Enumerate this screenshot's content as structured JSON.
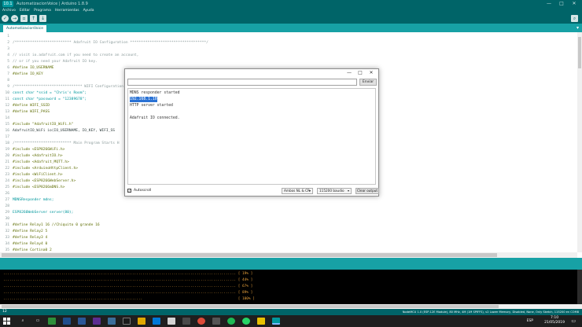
{
  "window": {
    "title": "AutomatizacionVoice | Arduino 1.8.9",
    "logo_text": "10.1",
    "minimize": "—",
    "maximize": "□",
    "close": "✕"
  },
  "menu": [
    "Archivo",
    "Editar",
    "Programa",
    "Herramientas",
    "Ayuda"
  ],
  "toolbar": {
    "verify_icon": "check-icon",
    "upload_icon": "arrow-right-icon",
    "new_icon": "new-file-icon",
    "open_icon": "arrow-up-icon",
    "save_icon": "arrow-down-icon",
    "serial_icon": "magnifier-icon",
    "verify_glyph": "✓",
    "upload_glyph": "→",
    "new_glyph": "▫",
    "open_glyph": "↑",
    "save_glyph": "↓",
    "serial_glyph": "⌕"
  },
  "tabs": {
    "active": "AutomatizacionVoice",
    "menu_glyph": "▾"
  },
  "code_lines": [
    {
      "n": "1",
      "text": "",
      "kind": "plain"
    },
    {
      "n": "2",
      "text": "/************************** Adafruit IO Configuration ***********************************/",
      "kind": "comment"
    },
    {
      "n": "3",
      "text": "",
      "kind": "plain"
    },
    {
      "n": "4",
      "text": "// visit io.adafruit.com if you need to create an account,",
      "kind": "comment"
    },
    {
      "n": "5",
      "text": "// or if you need your Adafruit IO key.",
      "kind": "comment"
    },
    {
      "n": "6",
      "text": "#define IO_USERNAME",
      "kind": "directive"
    },
    {
      "n": "7",
      "text": "#define IO_KEY",
      "kind": "directive"
    },
    {
      "n": "8",
      "text": "",
      "kind": "plain"
    },
    {
      "n": "9",
      "text": "/******************************* WIFI Configuration",
      "kind": "comment"
    },
    {
      "n": "10",
      "text": "const char *ssid = \"Chris's Room\";",
      "kind": "type"
    },
    {
      "n": "11",
      "text": "const char *password = \"12389678\";",
      "kind": "type"
    },
    {
      "n": "12",
      "text": "#define WIFI_SSID",
      "kind": "directive"
    },
    {
      "n": "13",
      "text": "#define WIFI_PASS",
      "kind": "directive"
    },
    {
      "n": "14",
      "text": "",
      "kind": "plain"
    },
    {
      "n": "15",
      "text": "#include \"AdafruitIO_WiFi.h\"",
      "kind": "directive"
    },
    {
      "n": "16",
      "text": "AdafruitIO_WiFi io(IO_USERNAME, IO_KEY, WIFI_SS",
      "kind": "plain"
    },
    {
      "n": "17",
      "text": "",
      "kind": "plain"
    },
    {
      "n": "18",
      "text": "/************************** Main Program Starts H",
      "kind": "comment"
    },
    {
      "n": "19",
      "text": "#include <ESP8266WiFi.h>",
      "kind": "directive"
    },
    {
      "n": "20",
      "text": "#include <AdafruitIO.h>",
      "kind": "directive"
    },
    {
      "n": "21",
      "text": "#include <Adafruit_MQTT.h>",
      "kind": "directive"
    },
    {
      "n": "22",
      "text": "#include <ArduinoHttpClient.h>",
      "kind": "directive"
    },
    {
      "n": "23",
      "text": "#include <WiFiClient.h>",
      "kind": "directive"
    },
    {
      "n": "24",
      "text": "#include <ESP8266WebServer.h>",
      "kind": "directive"
    },
    {
      "n": "25",
      "text": "#include <ESP8266mDNS.h>",
      "kind": "directive"
    },
    {
      "n": "26",
      "text": "",
      "kind": "plain"
    },
    {
      "n": "27",
      "text": "MDNSResponder mdns;",
      "kind": "type"
    },
    {
      "n": "28",
      "text": "",
      "kind": "plain"
    },
    {
      "n": "29",
      "text": "ESP8266WebServer server(80);",
      "kind": "type"
    },
    {
      "n": "30",
      "text": "",
      "kind": "plain"
    },
    {
      "n": "31",
      "text": "#define Relay1 16 //Chiquito 0 grande 16",
      "kind": "directive"
    },
    {
      "n": "32",
      "text": "#define Relay2 5",
      "kind": "directive"
    },
    {
      "n": "33",
      "text": "#define Relay3 4",
      "kind": "directive"
    },
    {
      "n": "34",
      "text": "#define Relay4 0",
      "kind": "directive"
    },
    {
      "n": "35",
      "text": "#define Cortina0 2",
      "kind": "directive"
    },
    {
      "n": "36",
      "text": "#define CortinaC 12",
      "kind": "directive"
    }
  ],
  "serial_monitor": {
    "minimize": "—",
    "maximize": "□",
    "close": "✕",
    "input_value": "",
    "send_label": "Enviar",
    "lines": [
      {
        "text": "MDNS responder started",
        "selected": false
      },
      {
        "text": "192.168.1.10",
        "selected": true
      },
      {
        "text": "HTTP server started",
        "selected": false
      },
      {
        "text": "",
        "selected": false
      },
      {
        "text": "Adafruit IO connected.",
        "selected": false
      }
    ],
    "autoscroll_label": "Autoscroll",
    "autoscroll_checked": "✓",
    "line_ending": "Ambos NL & CR",
    "baud_rate": "115200 baudio",
    "clear_label": "Clear output",
    "caret": "▾"
  },
  "console": {
    "lines": [
      "................................................................................................................ [ 19% ]",
      "................................................................................................................ [ 44% ]",
      "................................................................................................................ [ 67% ]",
      "................................................................................................................ [ 89% ]",
      "...................................................................                                              [ 100% ]"
    ]
  },
  "status": {
    "line_number": "12",
    "board_info": "NodeMCU 1.0 (ESP-12E Module), 80 MHz, 4M (1M SPIFFS), v2 Lower Memory, Disabled, None, Only Sketch, 115200 en COM8"
  },
  "taskbar": {
    "language": "ESP",
    "time": "7:10",
    "date": "21/05/2019",
    "notification_glyph": "▭"
  }
}
